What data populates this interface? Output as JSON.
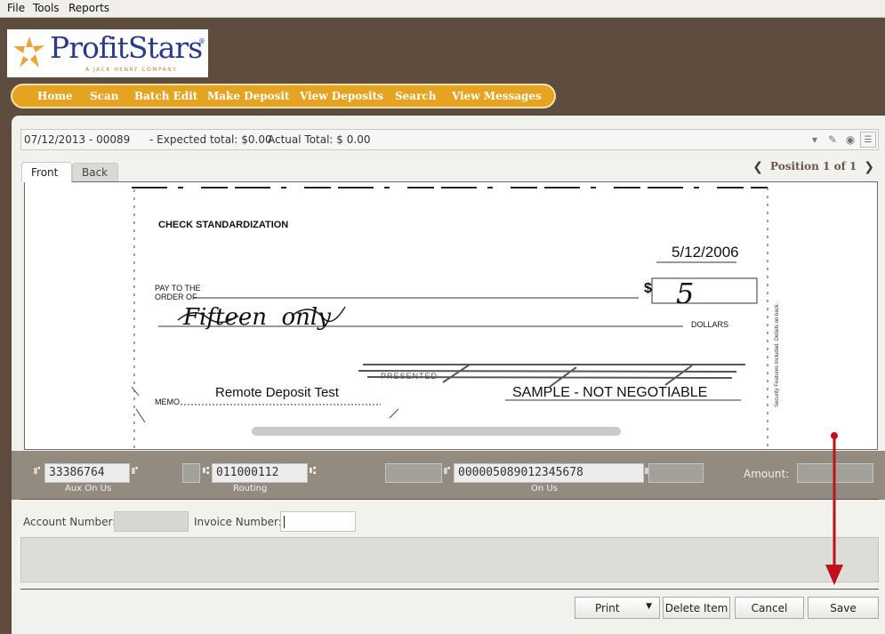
{
  "menu": [
    "File",
    "Tools",
    "Reports"
  ],
  "logo": {
    "brand": "ProfitStars",
    "registered": "®",
    "tagline": "A JACK HENRY COMPANY"
  },
  "nav": [
    "Home",
    "Scan",
    "Batch Edit",
    "Make Deposit",
    "View Deposits",
    "Search",
    "View Messages"
  ],
  "batch": {
    "id": "07/12/2013 - 00089",
    "expected": "- Expected total: $0.00",
    "actual": "Actual Total: $ 0.00"
  },
  "tabs": {
    "front": "Front",
    "back": "Back"
  },
  "position": {
    "prev": "❮",
    "label": "Position 1 of 1",
    "next": "❯"
  },
  "check": {
    "heading": "CHECK STANDARDIZATION",
    "date": "5/12/2006",
    "pay_to_line1": "PAY TO THE",
    "pay_to_line2": "ORDER OF",
    "dollar_sign": "$",
    "amount_handwritten": "5",
    "written_amount": "Fifteen  only",
    "dollars": "DOLLARS",
    "memo_label": "MEMO",
    "memo": "Remote Deposit Test",
    "stamp_word": "PRESENTED",
    "sample_notice": "SAMPLE - NOT NEGOTIABLE",
    "side_text": "Security Features Included. Details on back."
  },
  "micr": {
    "aux_on_us": "33386764",
    "aux_on_us_caption": "Aux On Us",
    "routing": "011000112",
    "routing_caption": "Routing",
    "on_us": "000005089012345678",
    "on_us_caption": "On Us",
    "symbol_onus": "⑈",
    "symbol_transit": "⑆",
    "amount_label": "Amount:"
  },
  "fields": {
    "account_label": "Account Number:",
    "account_value": "",
    "invoice_label": "Invoice Number:",
    "invoice_value": ""
  },
  "buttons": {
    "print": "Print",
    "print_dropdown": "▼",
    "delete": "Delete Item",
    "cancel": "Cancel",
    "save": "Save"
  },
  "colors": {
    "header": "#5e4d3f",
    "nav": "#e4a321",
    "micr_bar": "#938a80",
    "annotation_arrow": "#c0101a"
  }
}
